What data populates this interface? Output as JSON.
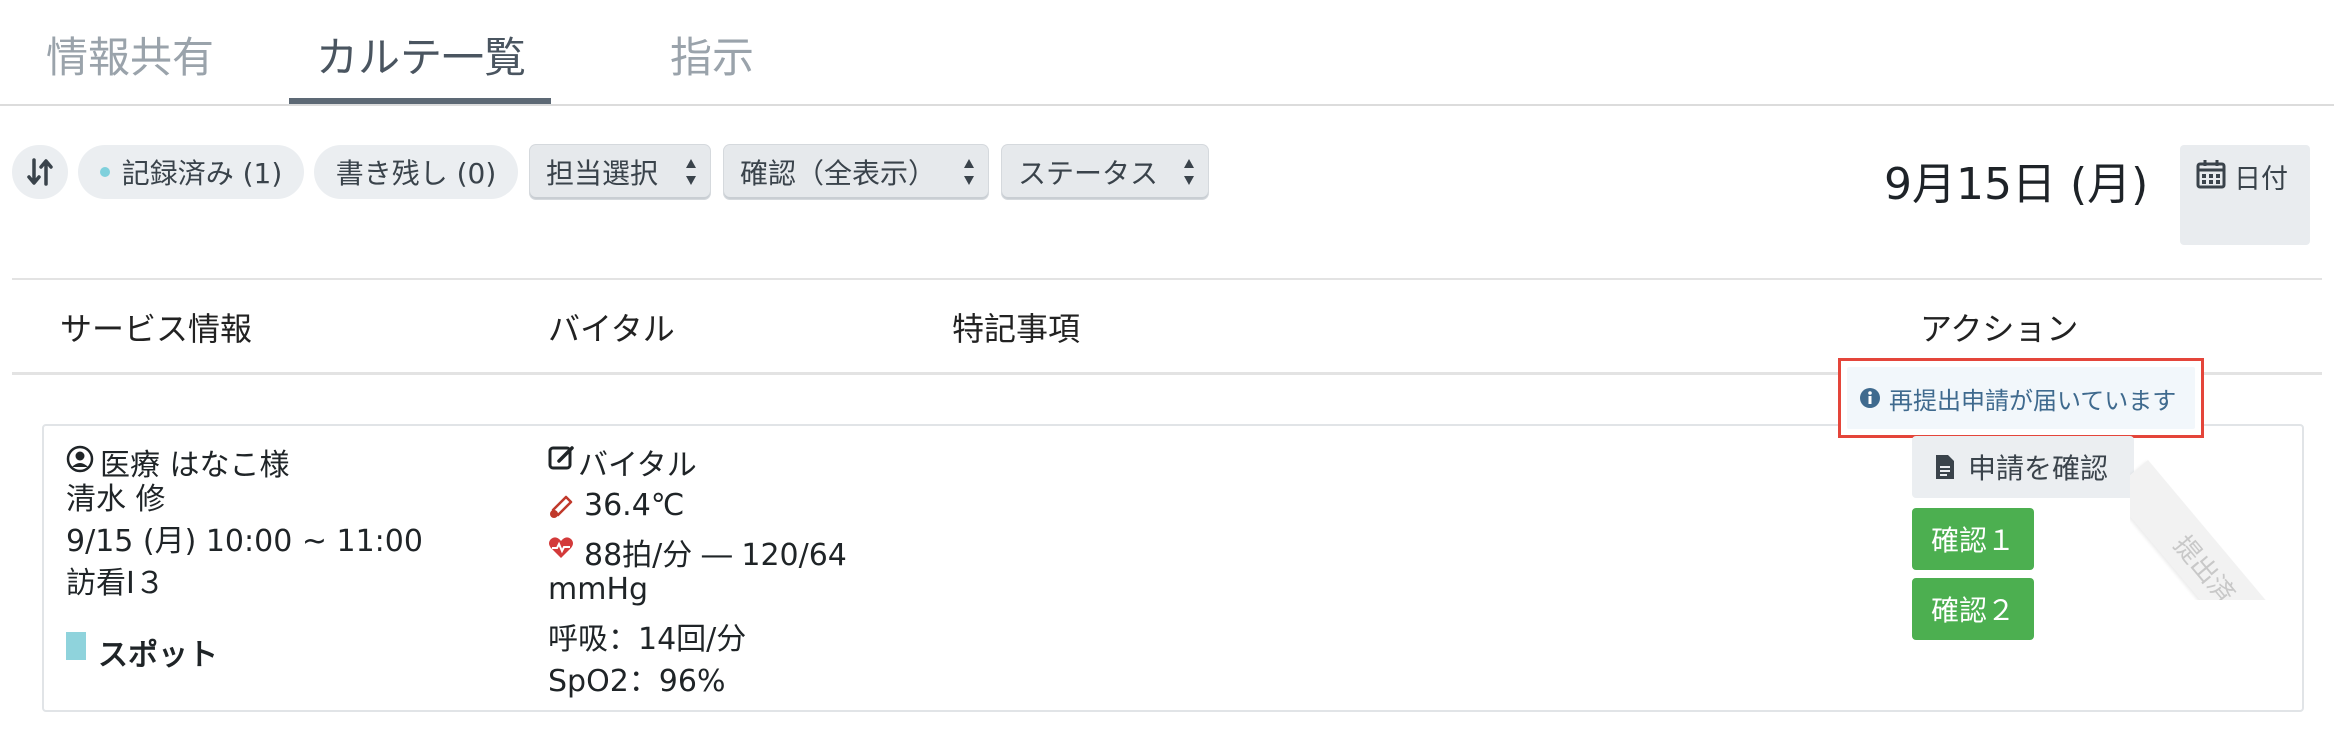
{
  "tabs": [
    {
      "label": "情報共有"
    },
    {
      "label": "カルテ一覧"
    },
    {
      "label": "指示"
    }
  ],
  "toolbar": {
    "recorded": "記録済み (1)",
    "unfinished": "書き残し (0)",
    "assignee": "担当選択",
    "confirm_filter": "確認（全表示）",
    "status": "ステータス",
    "date_title": "9月15日 (月)",
    "date_button": "日付"
  },
  "table": {
    "headers": [
      "サービス情報",
      "バイタル",
      "特記事項",
      "アクション"
    ]
  },
  "record": {
    "patient": "医療 はなこ様",
    "staff": "清水 修",
    "datetime": "9/15 (月) 10:00 ~ 11:00",
    "service_code": "訪看Ⅰ３",
    "visit_type": "スポット",
    "vitals_label": "バイタル",
    "temperature": "36.4℃",
    "pulse_bp": "88拍/分 ― 120/64",
    "bp_unit": "mmHg",
    "respiration": "呼吸：14回/分",
    "spo2": "SpO2：96%"
  },
  "actions": {
    "notice": "再提出申請が届いています",
    "check_request": "申請を確認",
    "confirm1": "確認１",
    "confirm2": "確認２",
    "ribbon": "提出済"
  },
  "colors": {
    "accent_green": "#4caf50",
    "notice_border": "#e4453a",
    "notice_text": "#3f6a8e",
    "spot_marker": "#8fd3dc"
  },
  "icons": {
    "sort": "sort-icon",
    "calendar": "calendar-icon",
    "user": "user-circle-icon",
    "edit": "edit-icon",
    "thermometer": "thermometer-icon",
    "heart": "heart-pulse-icon",
    "info": "info-icon",
    "document": "document-icon"
  }
}
